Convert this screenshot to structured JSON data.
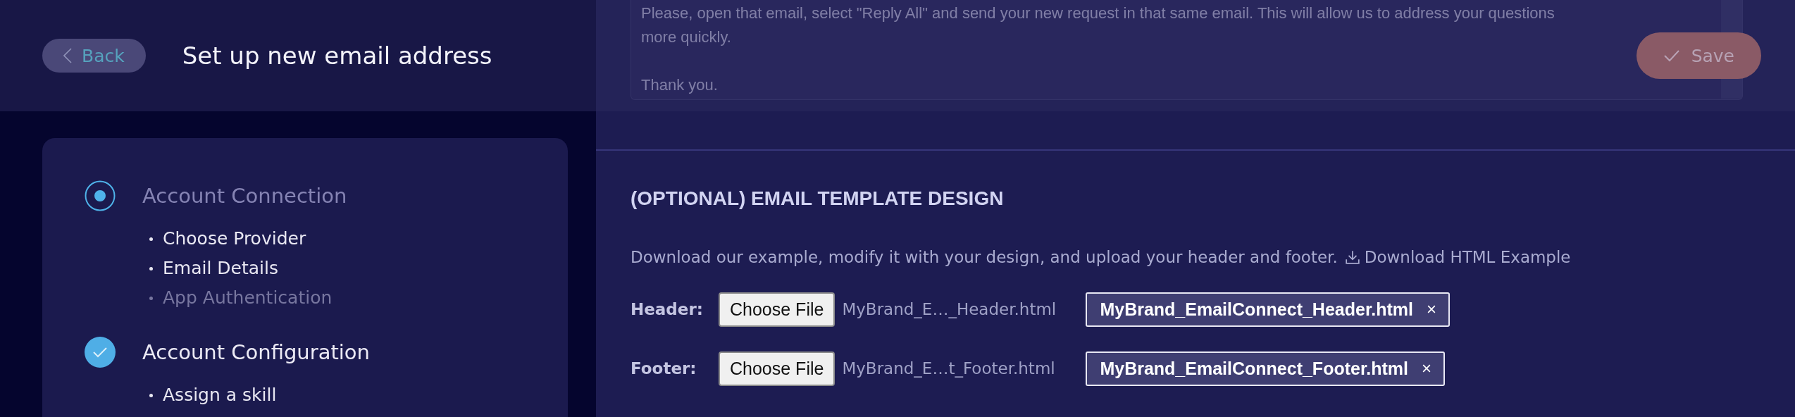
{
  "header": {
    "back_label": "Back",
    "title": "Set up new email address",
    "save_label": "Save"
  },
  "message_box": {
    "paragraphs": [
      "Please, open that email, select \"Reply All\" and send your new request in that same email. This will allow us to address your questions more quickly.",
      "Thank you."
    ]
  },
  "steps": [
    {
      "title": "Account Connection",
      "completed": false,
      "items": [
        {
          "label": "Choose Provider",
          "done": true
        },
        {
          "label": "Email Details",
          "done": true
        },
        {
          "label": "App Authentication",
          "done": false
        }
      ]
    },
    {
      "title": "Account Configuration",
      "completed": true,
      "items": [
        {
          "label": "Assign a skill",
          "done": true
        }
      ]
    }
  ],
  "template": {
    "heading": "(OPTIONAL) EMAIL TEMPLATE DESIGN",
    "description": "Download our example, modify it with your design, and upload your header and footer.",
    "download_link": "Download HTML Example",
    "uploads": [
      {
        "label": "Header:",
        "button": "Choose File",
        "file_name": "MyBrand_E…_Header.html",
        "chip": "MyBrand_EmailConnect_Header.html"
      },
      {
        "label": "Footer:",
        "button": "Choose File",
        "file_name": "MyBrand_E…t_Footer.html",
        "chip": "MyBrand_EmailConnect_Footer.html"
      }
    ]
  }
}
